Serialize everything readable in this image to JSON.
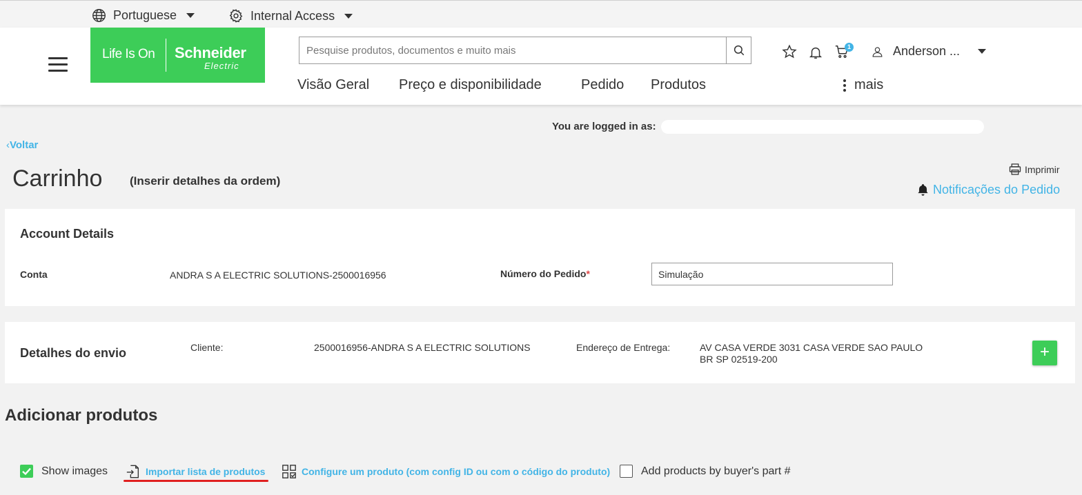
{
  "topbar": {
    "language": "Portuguese",
    "access": "Internal Access"
  },
  "header": {
    "logo_tagline": "Life Is On",
    "logo_brand": "Schneider",
    "logo_sub": "Electric",
    "search_placeholder": "Pesquise produtos, documentos e muito mais",
    "cart_count": "1",
    "user_name": "Anderson ...",
    "nav": [
      "Visão Geral",
      "Preço e disponibilidade",
      "Pedido",
      "Produtos"
    ],
    "more_label": "mais"
  },
  "session": {
    "logged_in_label": "You are logged in as:"
  },
  "page": {
    "back_label": "Voltar",
    "title": "Carrinho",
    "subtitle": "(Inserir detalhes da ordem)",
    "print_label": "Imprimir",
    "notifications_label": "Notificações do Pedido"
  },
  "account": {
    "heading": "Account Details",
    "conta_label": "Conta",
    "conta_value": "ANDRA S A ELECTRIC SOLUTIONS-2500016956",
    "order_number_label": "Número do Pedido",
    "required_mark": "*",
    "order_number_value": "Simulação"
  },
  "shipping": {
    "heading": "Detalhes do envio",
    "cliente_label": "Cliente:",
    "cliente_value": "2500016956-ANDRA S A ELECTRIC SOLUTIONS",
    "address_label": "Endereço de Entrega:",
    "address_line1": "AV CASA VERDE 3031 CASA VERDE SAO PAULO",
    "address_line2": "BR SP 02519-200",
    "add_button": "+"
  },
  "products": {
    "heading": "Adicionar produtos",
    "show_images_label": "Show images",
    "show_images_checked": true,
    "import_label": "Importar lista de produtos",
    "configure_label": "Configure um produto (com config ID ou com o código do produto)",
    "buyer_part_label": "Add products by buyer's part #",
    "buyer_part_checked": false
  },
  "colors": {
    "brand_green": "#3dcd58",
    "link_blue": "#42b4e6",
    "highlight_red": "#e02020"
  }
}
